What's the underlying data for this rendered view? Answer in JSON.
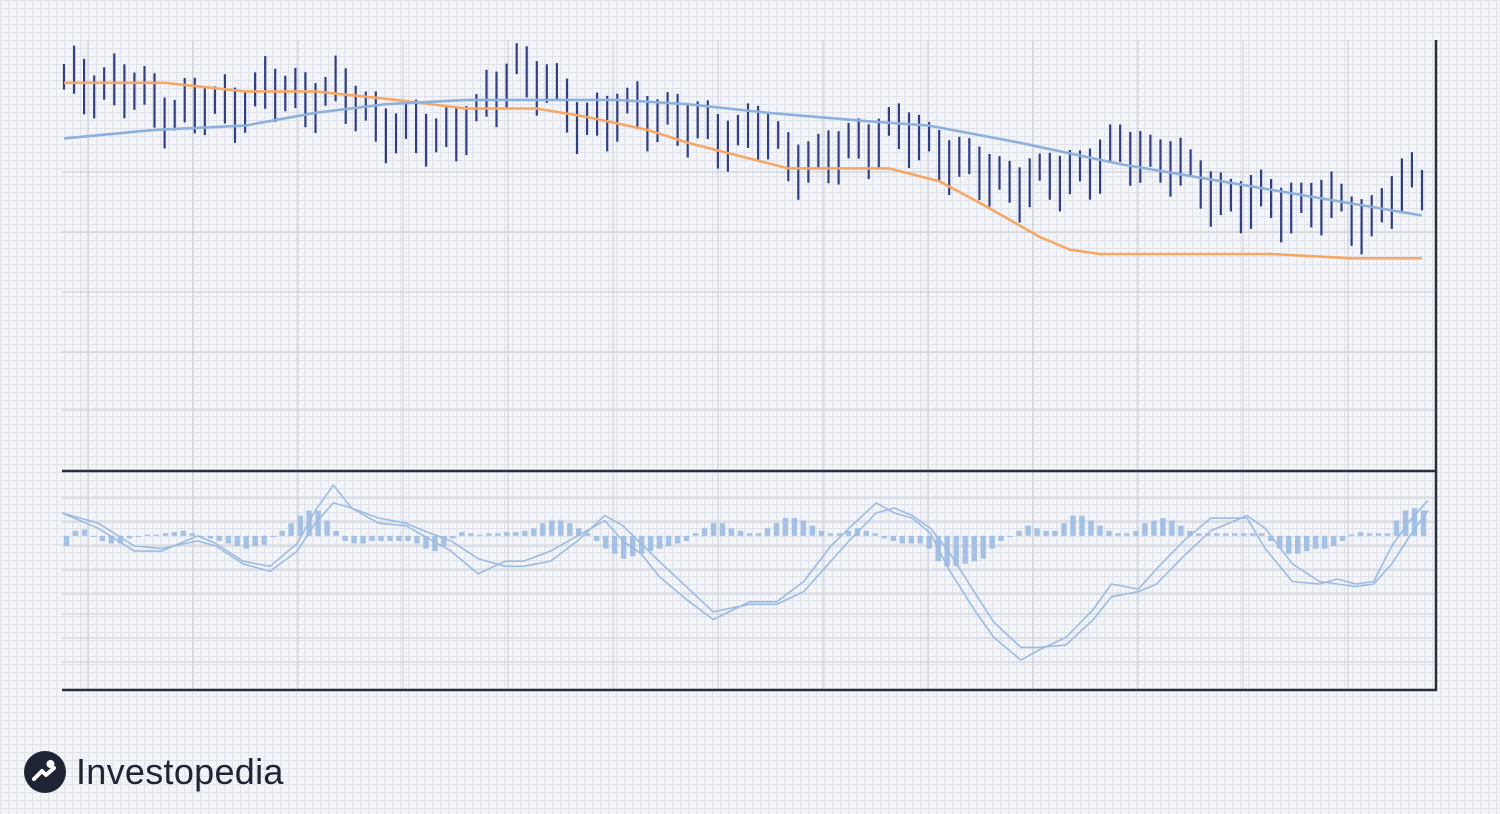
{
  "brand": {
    "name": "Investopedia"
  },
  "colors": {
    "price_bars": "#2f3f82",
    "ma_short": "#f5a866",
    "ma_long": "#8eb0dc",
    "macd": "#9cbbe2",
    "axis": "#2a2f3a",
    "grid": "#c9ccd3",
    "brand_dark": "#1e2433"
  },
  "chart_data": [
    {
      "panel": "price",
      "type": "ohlc-bar",
      "title": "",
      "xlabel": "",
      "ylabel": "",
      "ylim": [
        0,
        100
      ],
      "grid": true,
      "bar_count": 136,
      "close_series": [
        [
          0,
          90
        ],
        [
          4,
          90
        ],
        [
          7,
          88
        ],
        [
          10,
          84
        ],
        [
          14,
          84
        ],
        [
          17,
          85
        ],
        [
          20,
          88
        ],
        [
          23,
          87
        ],
        [
          27,
          88
        ],
        [
          31,
          82
        ],
        [
          34,
          78
        ],
        [
          37,
          78
        ],
        [
          41,
          82
        ],
        [
          43,
          87
        ],
        [
          45,
          95
        ],
        [
          48,
          89
        ],
        [
          51,
          82
        ],
        [
          54,
          82
        ],
        [
          57,
          83
        ],
        [
          60,
          83
        ],
        [
          62,
          80
        ],
        [
          65,
          78
        ],
        [
          69,
          79
        ],
        [
          72,
          73
        ],
        [
          75,
          72
        ],
        [
          77,
          73
        ],
        [
          79,
          76
        ],
        [
          82,
          79
        ],
        [
          87,
          75
        ],
        [
          90,
          70
        ],
        [
          92,
          68
        ],
        [
          95,
          67
        ],
        [
          98,
          67
        ],
        [
          101,
          70
        ],
        [
          104,
          73
        ],
        [
          107,
          74
        ],
        [
          110,
          72
        ],
        [
          112,
          68
        ],
        [
          115,
          64
        ],
        [
          118,
          62
        ],
        [
          121,
          62
        ],
        [
          124,
          62
        ],
        [
          127,
          61
        ],
        [
          130,
          58
        ],
        [
          132,
          63
        ],
        [
          134,
          67
        ],
        [
          135,
          66
        ]
      ],
      "series": [
        {
          "name": "",
          "type": "line",
          "points": [
            [
              0,
              90
            ],
            [
              10,
              90
            ],
            [
              18,
              88
            ],
            [
              25,
              88
            ],
            [
              33,
              86
            ],
            [
              40,
              84
            ],
            [
              47,
              84
            ],
            [
              52,
              82
            ],
            [
              58,
              79
            ],
            [
              62,
              76
            ],
            [
              67,
              73
            ],
            [
              72,
              70
            ],
            [
              76,
              70
            ],
            [
              82,
              70
            ],
            [
              87,
              67
            ],
            [
              91,
              62
            ],
            [
              94,
              58
            ],
            [
              97,
              54
            ],
            [
              100,
              51
            ],
            [
              103,
              50
            ],
            [
              110,
              50
            ],
            [
              120,
              50
            ],
            [
              128,
              49
            ],
            [
              135,
              49
            ]
          ]
        },
        {
          "name": "",
          "type": "line",
          "points": [
            [
              0,
              77
            ],
            [
              9,
              79
            ],
            [
              18,
              80
            ],
            [
              25,
              83
            ],
            [
              32,
              85
            ],
            [
              40,
              86
            ],
            [
              55,
              86
            ],
            [
              62,
              85
            ],
            [
              70,
              83
            ],
            [
              80,
              81
            ],
            [
              86,
              80
            ],
            [
              95,
              76
            ],
            [
              105,
              71
            ],
            [
              115,
              67
            ],
            [
              125,
              63
            ],
            [
              135,
              59
            ]
          ]
        }
      ]
    },
    {
      "panel": "macd",
      "type": "line",
      "title": "",
      "xlabel": "",
      "ylabel": "",
      "ylim": [
        -6,
        2.4
      ],
      "grid": true,
      "series": [
        {
          "name": "",
          "type": "line",
          "points": [
            [
              0,
              0.9
            ],
            [
              4,
              0.3
            ],
            [
              8,
              -0.6
            ],
            [
              11,
              -0.6
            ],
            [
              15,
              0
            ],
            [
              17,
              -0.3
            ],
            [
              20,
              -1
            ],
            [
              23,
              -1.2
            ],
            [
              26,
              -0.3
            ],
            [
              28,
              1
            ],
            [
              30,
              2
            ],
            [
              32,
              1.1
            ],
            [
              35,
              0.5
            ],
            [
              38,
              0.4
            ],
            [
              40,
              0
            ],
            [
              43,
              -0.6
            ],
            [
              46,
              -1.5
            ],
            [
              49,
              -1
            ],
            [
              51,
              -1
            ],
            [
              54,
              -0.6
            ],
            [
              57,
              0
            ],
            [
              60,
              0.6
            ],
            [
              62,
              -0.2
            ],
            [
              64,
              -0.7
            ],
            [
              66,
              -1.6
            ],
            [
              69,
              -2.5
            ],
            [
              72,
              -3.3
            ],
            [
              76,
              -2.6
            ],
            [
              79,
              -2.6
            ],
            [
              82,
              -1.8
            ],
            [
              85,
              -0.4
            ],
            [
              87,
              0.3
            ],
            [
              90,
              1.3
            ],
            [
              92,
              0.9
            ],
            [
              94,
              0.7
            ],
            [
              96,
              0.1
            ],
            [
              98,
              -1.3
            ],
            [
              101,
              -3
            ],
            [
              103,
              -4
            ],
            [
              106,
              -4.9
            ],
            [
              108,
              -4.5
            ],
            [
              111,
              -4
            ],
            [
              114,
              -2.9
            ],
            [
              116,
              -1.9
            ],
            [
              119,
              -2.1
            ],
            [
              121,
              -1.3
            ],
            [
              124,
              -0.2
            ],
            [
              127,
              0.7
            ],
            [
              131,
              0.7
            ],
            [
              133,
              -0.5
            ],
            [
              136,
              -1.8
            ],
            [
              139,
              -1.9
            ],
            [
              141,
              -1.7
            ],
            [
              143,
              -1.9
            ],
            [
              145,
              -1.8
            ],
            [
              147,
              -0.4
            ],
            [
              149,
              0.6
            ],
            [
              151,
              1.4
            ]
          ]
        },
        {
          "name": "",
          "type": "line",
          "points": [
            [
              0,
              0.9
            ],
            [
              4,
              0.5
            ],
            [
              8,
              -0.4
            ],
            [
              11,
              -0.5
            ],
            [
              15,
              -0.2
            ],
            [
              17,
              -0.4
            ],
            [
              20,
              -1.1
            ],
            [
              23,
              -1.4
            ],
            [
              26,
              -0.6
            ],
            [
              28,
              0.5
            ],
            [
              30,
              1.3
            ],
            [
              32,
              1.1
            ],
            [
              35,
              0.7
            ],
            [
              38,
              0.5
            ],
            [
              40,
              0.2
            ],
            [
              43,
              -0.2
            ],
            [
              46,
              -0.9
            ],
            [
              49,
              -1.2
            ],
            [
              51,
              -1.2
            ],
            [
              54,
              -1
            ],
            [
              57,
              -0.2
            ],
            [
              60,
              0.8
            ],
            [
              62,
              0.4
            ],
            [
              64,
              -0.3
            ],
            [
              66,
              -1
            ],
            [
              69,
              -2
            ],
            [
              72,
              -3
            ],
            [
              76,
              -2.7
            ],
            [
              79,
              -2.7
            ],
            [
              82,
              -2.2
            ],
            [
              85,
              -1
            ],
            [
              87,
              -0.2
            ],
            [
              90,
              0.9
            ],
            [
              92,
              1.1
            ],
            [
              94,
              0.8
            ],
            [
              96,
              0.3
            ],
            [
              98,
              -0.6
            ],
            [
              101,
              -2.3
            ],
            [
              103,
              -3.4
            ],
            [
              106,
              -4.4
            ],
            [
              108,
              -4.4
            ],
            [
              111,
              -4.3
            ],
            [
              114,
              -3.3
            ],
            [
              116,
              -2.4
            ],
            [
              119,
              -2.2
            ],
            [
              121,
              -1.9
            ],
            [
              124,
              -0.8
            ],
            [
              127,
              0.2
            ],
            [
              131,
              0.8
            ],
            [
              133,
              0.3
            ],
            [
              136,
              -1.1
            ],
            [
              139,
              -1.8
            ],
            [
              141,
              -1.9
            ],
            [
              143,
              -2
            ],
            [
              145,
              -1.9
            ],
            [
              147,
              -1.1
            ],
            [
              149,
              0
            ],
            [
              151,
              1
            ]
          ]
        }
      ],
      "histogram": [
        -0.4,
        0.2,
        0.25,
        0,
        -0.2,
        -0.3,
        -0.3,
        -0.1,
        0,
        0.05,
        0.05,
        0.1,
        0.15,
        0.2,
        0.1,
        0,
        -0.1,
        -0.2,
        -0.3,
        -0.4,
        -0.5,
        -0.4,
        -0.35,
        0,
        0.2,
        0.5,
        0.8,
        1,
        1,
        0.6,
        0.2,
        -0.2,
        -0.3,
        -0.3,
        -0.2,
        -0.2,
        -0.2,
        -0.2,
        -0.2,
        -0.3,
        -0.5,
        -0.6,
        -0.4,
        -0.1,
        0.15,
        0.1,
        0.05,
        0.1,
        0.1,
        0.15,
        0.15,
        0.2,
        0.3,
        0.5,
        0.6,
        0.6,
        0.5,
        0.3,
        0.1,
        -0.2,
        -0.5,
        -0.7,
        -0.9,
        -0.8,
        -0.7,
        -0.6,
        -0.5,
        -0.4,
        -0.3,
        -0.2,
        0.1,
        0.3,
        0.5,
        0.5,
        0.3,
        0.2,
        0.1,
        0.1,
        0.3,
        0.5,
        0.7,
        0.7,
        0.6,
        0.4,
        0.2,
        0.1,
        0.1,
        0.2,
        0.3,
        0.2,
        0.1,
        -0.1,
        -0.2,
        -0.3,
        -0.3,
        -0.3,
        -0.5,
        -1,
        -1.2,
        -1.2,
        -1.1,
        -1,
        -0.9,
        -0.5,
        -0.2,
        0,
        0.2,
        0.4,
        0.3,
        0.2,
        0.2,
        0.5,
        0.8,
        0.8,
        0.6,
        0.4,
        0.2,
        0.1,
        0.1,
        0.2,
        0.5,
        0.6,
        0.7,
        0.6,
        0.4,
        0.2,
        0.1,
        0.1,
        0.1,
        0.1,
        0.1,
        0.1,
        0.1,
        0.1,
        -0.2,
        -0.5,
        -0.7,
        -0.7,
        -0.6,
        -0.5,
        -0.5,
        -0.4,
        -0.2,
        0.05,
        0.15,
        0.1,
        0.1,
        0.1,
        0.6,
        1,
        1.1,
        1
      ]
    }
  ]
}
